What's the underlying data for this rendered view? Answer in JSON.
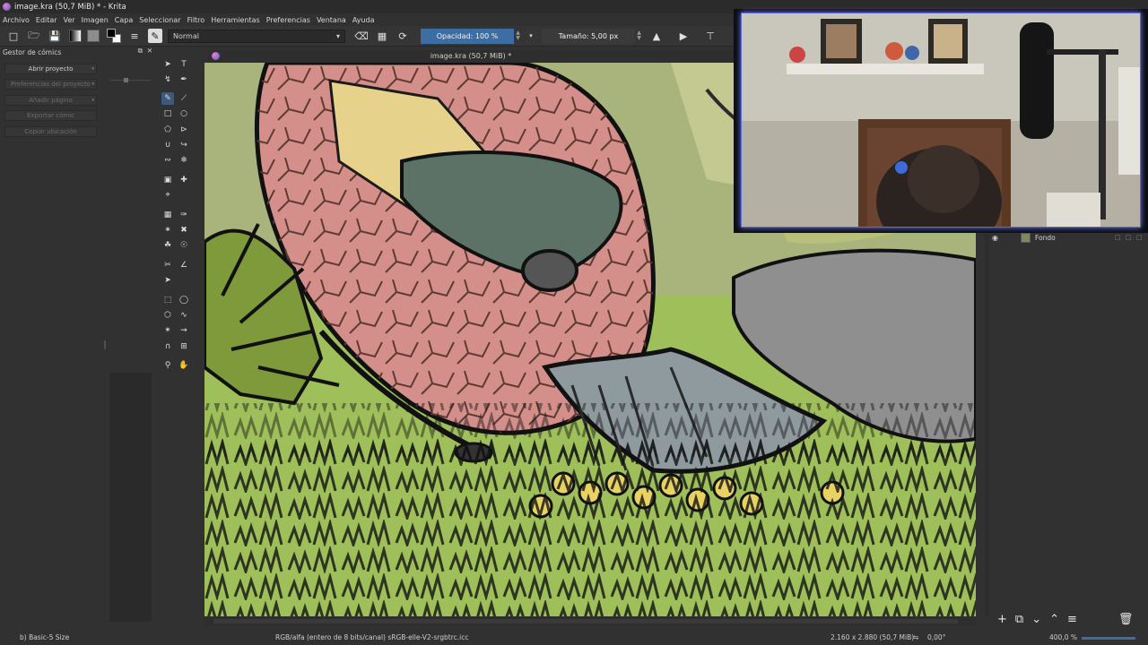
{
  "app": {
    "title": "image.kra (50,7 MiB) * - Krita"
  },
  "menu": [
    "Archivo",
    "Editar",
    "Ver",
    "Imagen",
    "Capa",
    "Seleccionar",
    "Filtro",
    "Herramientas",
    "Preferencias",
    "Ventana",
    "Ayuda"
  ],
  "toolbar": {
    "blend_mode": "Normal",
    "opacity_label": "Opacidad: 100 %",
    "size_label": "Tamaño: 5,00 px"
  },
  "comics_manager": {
    "title": "Gestor de cómics",
    "buttons": [
      "Abrir proyecto",
      "Preferencias del proyecto",
      "Añadir página",
      "Exportar cómic",
      "Copiar ubicación"
    ]
  },
  "canvas": {
    "document_title": "image.kra (50,7 MiB) *"
  },
  "layers": {
    "items": [
      {
        "name": "Fondo"
      }
    ]
  },
  "status": {
    "brush_preset": "b) Basic-5 Size",
    "color_profile": "RGB/alfa (entero de 8 bits/canal)  sRGB-elle-V2-srgbtrc.icc",
    "image_size": "2.160 x 2.880 (50,7 MiB)",
    "rotation": "0,00°",
    "zoom": "400,0 %"
  },
  "colors": {
    "accent": "#3c6ea3",
    "background": "#313131",
    "foreground": "#000000",
    "background_color_swatch": "#ffffff"
  },
  "icons": {
    "toolbar": [
      "new-document-icon",
      "open-document-icon",
      "save-icon",
      "gradient-icon",
      "pattern-icon",
      "fg-bg-color-icon",
      "brush-settings-icon",
      "brush-preset-icon",
      "eraser-icon",
      "preserve-alpha-icon",
      "reload-preset-icon",
      "mirror-horizontal-icon",
      "mirror-vertical-icon",
      "wrap-icon"
    ],
    "tools": [
      "select-shapes-icon",
      "text-icon",
      "edit-shapes-icon",
      "calligraphy-icon",
      "freehand-brush-icon",
      "line-icon",
      "rectangle-icon",
      "ellipse-icon",
      "polygon-icon",
      "polyline-icon",
      "bezier-icon",
      "freehand-path-icon",
      "dynamic-brush-icon",
      "multibrush-icon",
      "transform-icon",
      "move-icon",
      "crop-icon",
      "gradient-tool-icon",
      "color-picker-icon",
      "colorize-mask-icon",
      "smart-patch-icon",
      "fill-icon",
      "fill-enclose-icon",
      "assistant-icon",
      "measure-icon",
      "reference-icon",
      "rect-select-icon",
      "ellipse-select-icon",
      "polygon-select-icon",
      "freehand-select-icon",
      "contiguous-select-icon",
      "similar-select-icon",
      "bezier-select-icon",
      "magnetic-select-icon",
      "zoom-icon",
      "pan-icon"
    ]
  }
}
